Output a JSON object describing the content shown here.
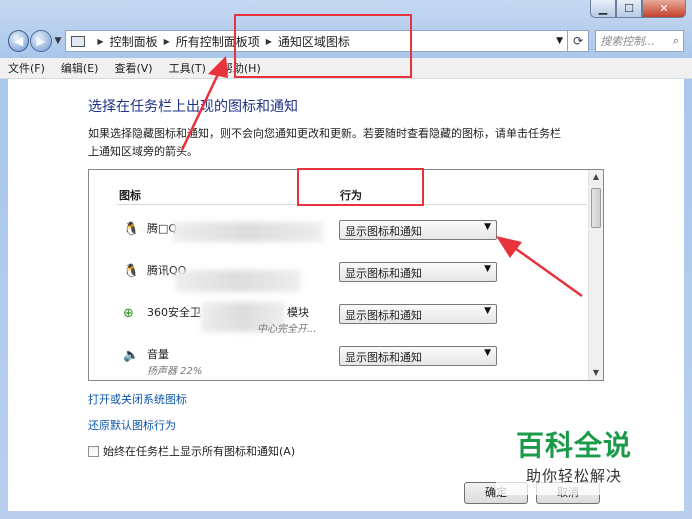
{
  "window": {
    "caption_buttons": [
      "minimize-icon",
      "maximize-icon",
      "close-icon"
    ]
  },
  "nav": {
    "breadcrumb": [
      "控制面板",
      "所有控制面板项",
      "通知区域图标"
    ],
    "search_placeholder": "搜索控制..."
  },
  "menu": [
    "文件(F)",
    "编辑(E)",
    "查看(V)",
    "工具(T)",
    "帮助(H)"
  ],
  "page": {
    "title": "选择在任务栏上出现的图标和通知",
    "description": "如果选择隐藏图标和通知，则不会向您通知更改和更新。若要随时查看隐藏的图标，请单击任务栏上通知区域旁的箭头。",
    "col_icon": "图标",
    "col_behavior": "行为",
    "rows": [
      {
        "name": "腾□Q",
        "sub": "",
        "value": "显示图标和通知",
        "icon": "qq-penguin-icon"
      },
      {
        "name": "腾讯QQ",
        "sub": "",
        "value": "显示图标和通知",
        "icon": "qq-penguin-icon"
      },
      {
        "name": "360安全卫",
        "name2": "模块",
        "sub": "中心完全开...",
        "value": "显示图标和通知",
        "icon": "360-shield-icon"
      },
      {
        "name": "音量",
        "sub": "扬声器 22%",
        "value": "显示图标和通知",
        "icon": "speaker-icon"
      }
    ],
    "link_system_icons": "打开或关闭系统图标",
    "link_restore": "还原默认图标行为",
    "always_show_label": "始终在任务栏上显示所有图标和通知(A)",
    "ok_label": "确定",
    "cancel_label": "取消"
  },
  "watermark": {
    "title": "百科全说",
    "subtitle": "助你轻松解决"
  },
  "colors": {
    "annotation": "#e8323c",
    "heading": "#1e3287",
    "link": "#0b55b0",
    "watermark": "#1b9b4a"
  }
}
